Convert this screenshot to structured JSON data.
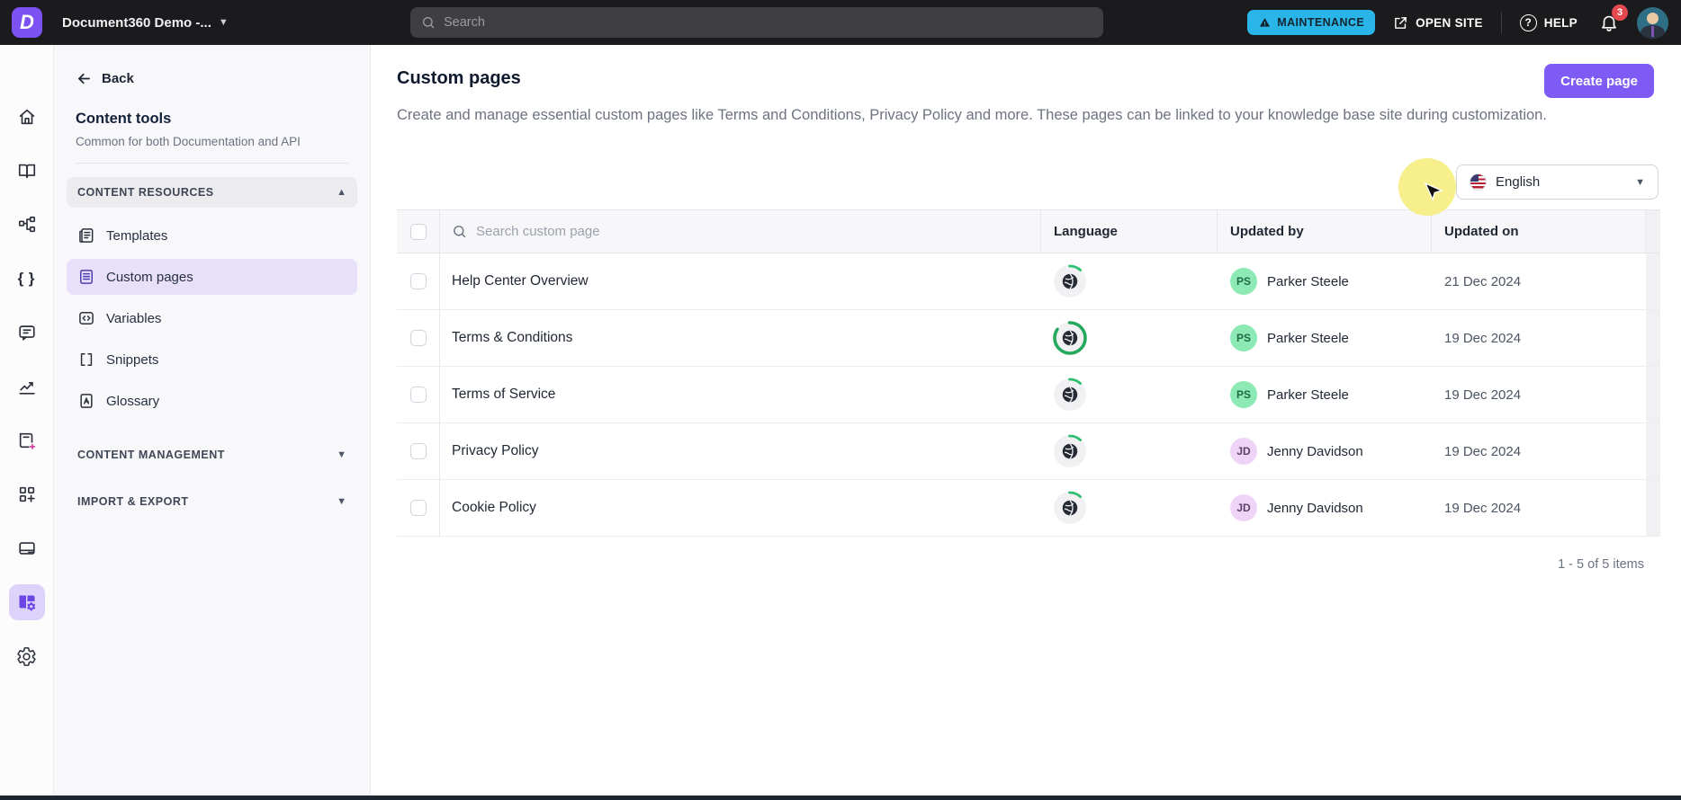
{
  "topbar": {
    "project_name": "Document360 Demo -...",
    "search_placeholder": "Search",
    "maintenance_label": "MAINTENANCE",
    "open_site_label": "OPEN SITE",
    "help_label": "HELP",
    "notification_count": "3"
  },
  "rail": {
    "icons": [
      "home-icon",
      "knowledge-base-icon",
      "sitemap-icon",
      "code-braces-icon",
      "feedback-icon",
      "analytics-icon",
      "book-add-icon",
      "widgets-icon",
      "browser-card-icon",
      "content-tools-icon",
      "settings-icon"
    ],
    "active_icon": "content-tools-icon"
  },
  "sidebar": {
    "back_label": "Back",
    "title": "Content tools",
    "subtitle": "Common for both Documentation and API",
    "sections": [
      {
        "label": "CONTENT RESOURCES",
        "expanded": true,
        "items": [
          {
            "label": "Templates",
            "selected": false
          },
          {
            "label": "Custom pages",
            "selected": true
          },
          {
            "label": "Variables",
            "selected": false
          },
          {
            "label": "Snippets",
            "selected": false
          },
          {
            "label": "Glossary",
            "selected": false
          }
        ]
      },
      {
        "label": "CONTENT MANAGEMENT",
        "expanded": false
      },
      {
        "label": "IMPORT & EXPORT",
        "expanded": false
      }
    ]
  },
  "main": {
    "title": "Custom pages",
    "description": "Create and manage essential custom pages like Terms and Conditions, Privacy Policy and more. These pages can be linked to your knowledge base site during customization.",
    "create_button_label": "Create page",
    "language_selector": {
      "value": "English",
      "flag": "us-flag-icon"
    },
    "table": {
      "search_placeholder": "Search custom page",
      "columns": [
        "Language",
        "Updated by",
        "Updated on"
      ],
      "rows": [
        {
          "name": "Help Center Overview",
          "updated_by": "Parker Steele",
          "initials": "PS",
          "updated_on": "21 Dec 2024",
          "translation_progress": 12,
          "avatar_bg": "#8deab5",
          "avatar_fg": "#1f6b45"
        },
        {
          "name": "Terms & Conditions",
          "updated_by": "Parker Steele",
          "initials": "PS",
          "updated_on": "19 Dec 2024",
          "translation_progress": 85,
          "avatar_bg": "#8deab5",
          "avatar_fg": "#1f6b45"
        },
        {
          "name": "Terms of Service",
          "updated_by": "Parker Steele",
          "initials": "PS",
          "updated_on": "19 Dec 2024",
          "translation_progress": 12,
          "avatar_bg": "#8deab5",
          "avatar_fg": "#1f6b45"
        },
        {
          "name": "Privacy Policy",
          "updated_by": "Jenny Davidson",
          "initials": "JD",
          "updated_on": "19 Dec 2024",
          "translation_progress": 12,
          "avatar_bg": "#f0d4f7",
          "avatar_fg": "#5d3f69"
        },
        {
          "name": "Cookie Policy",
          "updated_by": "Jenny Davidson",
          "initials": "JD",
          "updated_on": "19 Dec 2024",
          "translation_progress": 12,
          "avatar_bg": "#f0d4f7",
          "avatar_fg": "#5d3f69"
        }
      ],
      "footer": "1 - 5 of 5 items"
    }
  },
  "colors": {
    "accent_purple": "#7e5bf5",
    "selection_purple": "#e8e0fb",
    "maintenance_cyan": "#29b5e8",
    "progress_green": "#2fbf71",
    "notification_red": "#e5484d",
    "topbar_bg": "#1b1b1d"
  }
}
